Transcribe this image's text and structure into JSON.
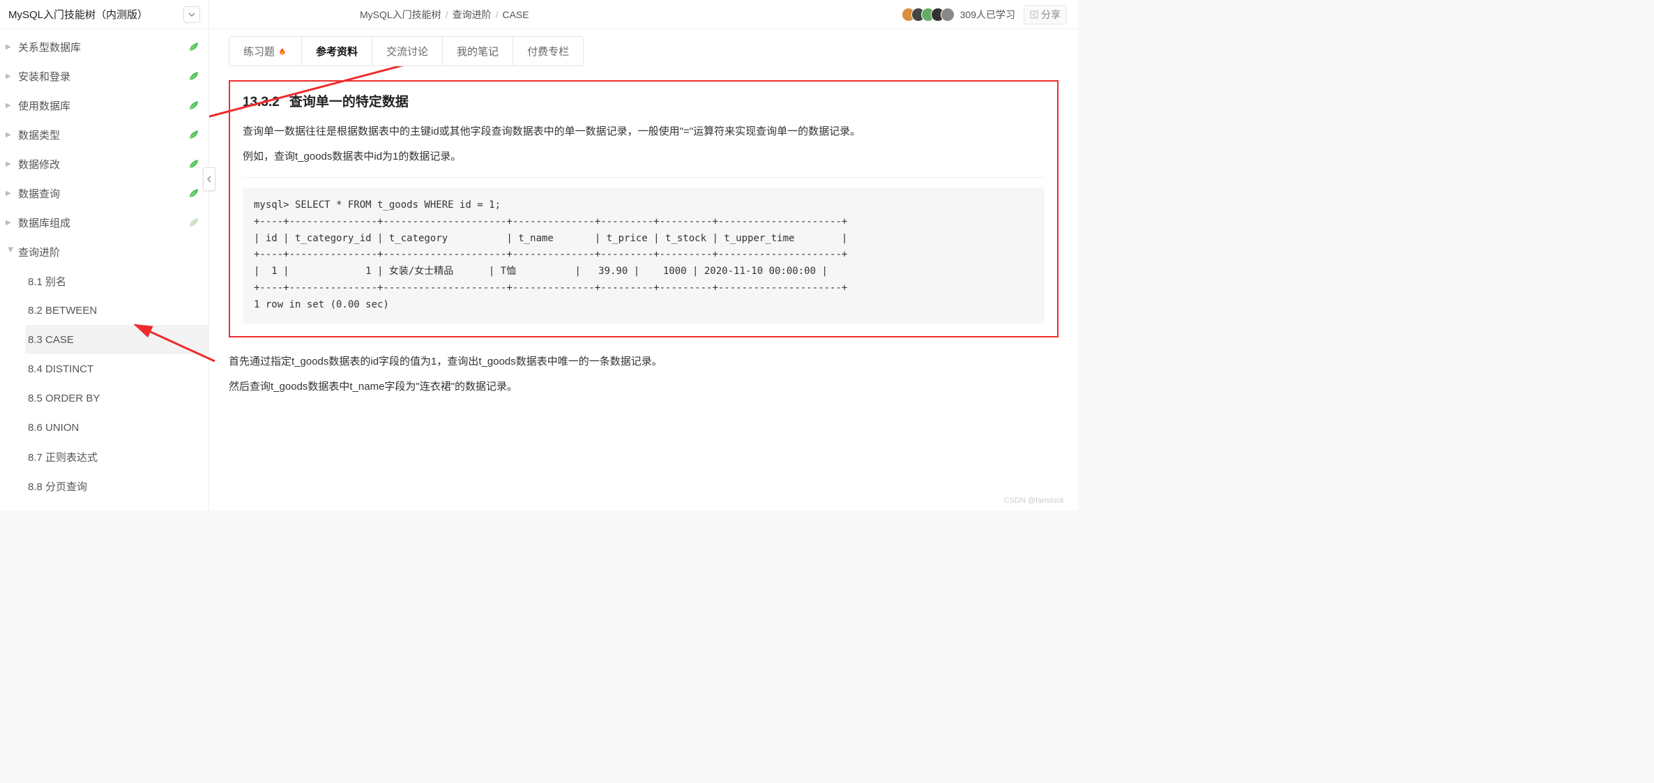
{
  "sidebar": {
    "title": "MySQL入门技能树（内测版）",
    "items": [
      {
        "label": "关系型数据库",
        "hasLeaf": true,
        "leafColor": "#3fbf4a"
      },
      {
        "label": "安装和登录",
        "hasLeaf": true,
        "leafColor": "#3fbf4a"
      },
      {
        "label": "使用数据库",
        "hasLeaf": true,
        "leafColor": "#3fbf4a"
      },
      {
        "label": "数据类型",
        "hasLeaf": true,
        "leafColor": "#3fbf4a"
      },
      {
        "label": "数据修改",
        "hasLeaf": true,
        "leafColor": "#3fbf4a"
      },
      {
        "label": "数据查询",
        "hasLeaf": true,
        "leafColor": "#3fbf4a"
      },
      {
        "label": "数据库组成",
        "hasLeaf": true,
        "leafColor": "#c9d9c0"
      }
    ],
    "expanded": {
      "label": "查询进阶",
      "children": [
        {
          "label": "8.1 别名"
        },
        {
          "label": "8.2 BETWEEN"
        },
        {
          "label": "8.3 CASE",
          "active": true
        },
        {
          "label": "8.4 DISTINCT"
        },
        {
          "label": "8.5 ORDER BY"
        },
        {
          "label": "8.6 UNION"
        },
        {
          "label": "8.7 正则表达式"
        },
        {
          "label": "8.8 分页查询"
        }
      ]
    }
  },
  "breadcrumb": {
    "a": "MySQL入门技能树",
    "b": "查询进阶",
    "c": "CASE"
  },
  "topbar": {
    "learnCount": "309人已学习",
    "share": "分享"
  },
  "tabs": [
    {
      "label": "练习题",
      "fire": true
    },
    {
      "label": "参考资料",
      "active": true
    },
    {
      "label": "交流讨论"
    },
    {
      "label": "我的笔记"
    },
    {
      "label": "付费专栏"
    }
  ],
  "article": {
    "sectionNum": "13.3.2",
    "sectionTitle": "查询单一的特定数据",
    "p1": "查询单一数据往往是根据数据表中的主键id或其他字段查询数据表中的单一数据记录，一般使用\"=\"运算符来实现查询单一的数据记录。",
    "p2": "例如，查询t_goods数据表中id为1的数据记录。",
    "code": "mysql> SELECT * FROM t_goods WHERE id = 1;\n+----+---------------+---------------------+--------------+---------+---------+---------------------+\n| id | t_category_id | t_category          | t_name       | t_price | t_stock | t_upper_time        |\n+----+---------------+---------------------+--------------+---------+---------+---------------------+\n|  1 |             1 | 女装/女士精品      | T恤          |   39.90 |    1000 | 2020-11-10 00:00:00 |\n+----+---------------+---------------------+--------------+---------+---------+---------------------+\n1 row in set (0.00 sec)",
    "p3": "首先通过指定t_goods数据表的id字段的值为1，查询出t_goods数据表中唯一的一条数据记录。",
    "p4": "然后查询t_goods数据表中t_name字段为\"连衣裙\"的数据记录。"
  },
  "avatars": [
    "#d98f3f",
    "#444",
    "#6a6",
    "#333",
    "#888"
  ],
  "watermark": "CSDN @fanstuck"
}
